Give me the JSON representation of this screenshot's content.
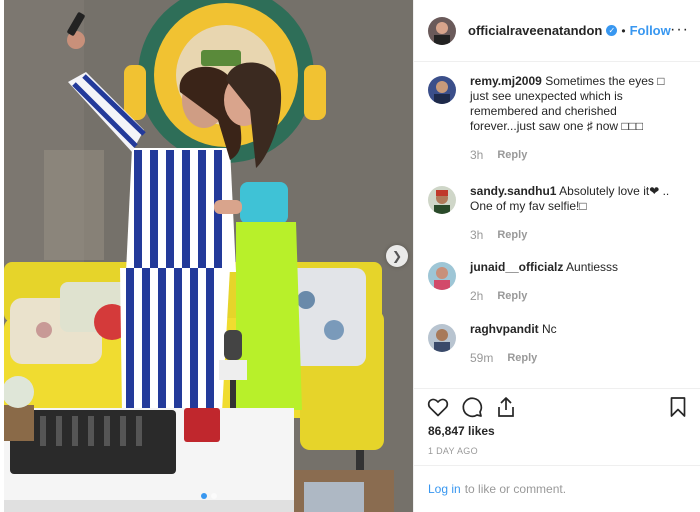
{
  "post": {
    "author": "officialraveenatandon",
    "follow_label": "Follow",
    "bullet": "•",
    "more_label": "···"
  },
  "comments": [
    {
      "user": "remy.mj2009",
      "text": "Sometimes the eyes □ just see unexpected which is remembered and cherished forever...just saw one ♯ now □□□",
      "time": "3h",
      "reply_label": "Reply"
    },
    {
      "user": "sandy.sandhu1",
      "text": "Absolutely love it❤ .. One of my fav selfie!□",
      "time": "3h",
      "reply_label": "Reply"
    },
    {
      "user": "junaid__officialz",
      "text": "Auntiesss",
      "time": "2h",
      "reply_label": "Reply"
    },
    {
      "user": "raghvpandit",
      "text": "Nc",
      "time": "59m",
      "reply_label": "Reply"
    }
  ],
  "likes_text": "86,847 likes",
  "date_text": "1 DAY AGO",
  "login": {
    "link_label": "Log in",
    "suffix": "to like or comment."
  },
  "icons": {
    "heart": "heart-icon",
    "comment": "comment-icon",
    "share": "share-icon",
    "save": "bookmark-icon",
    "next": "chevron-right-icon",
    "verified": "verified-badge-icon"
  },
  "colors": {
    "accent": "#3897f0",
    "muted": "#999999",
    "text": "#262626"
  }
}
